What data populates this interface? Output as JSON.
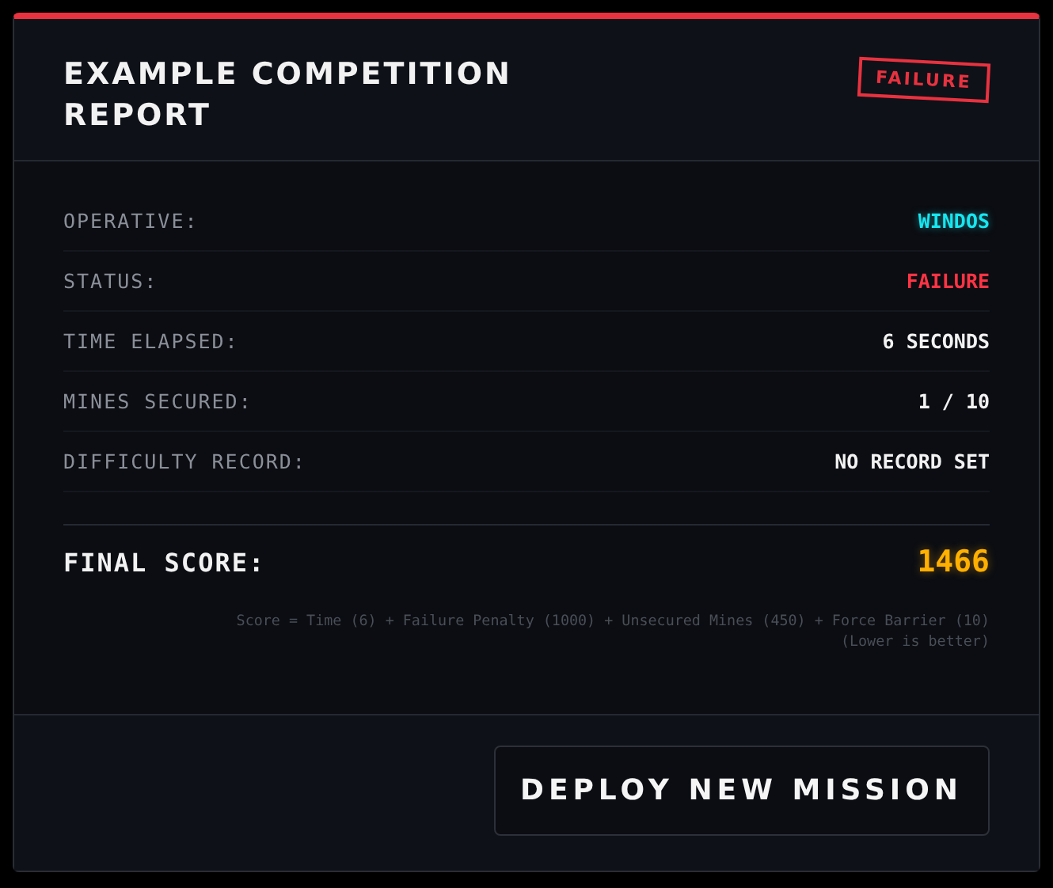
{
  "header": {
    "title": "EXAMPLE COMPETITION REPORT",
    "stamp": "FAILURE",
    "failed": true
  },
  "stats": [
    {
      "label": "OPERATIVE:",
      "value": "WINDOS",
      "kind": "highlight"
    },
    {
      "label": "STATUS:",
      "value": "FAILURE",
      "kind": "failure"
    },
    {
      "label": "TIME ELAPSED:",
      "value": "6 SECONDS",
      "kind": "plain"
    },
    {
      "label": "MINES SECURED:",
      "value": "1 / 10",
      "kind": "plain"
    },
    {
      "label": "DIFFICULTY RECORD:",
      "value": "NO RECORD SET",
      "kind": "plain"
    }
  ],
  "final_score": {
    "label": "FINAL SCORE:",
    "value": "1466"
  },
  "formula": [
    "Score = Time (6) + Failure Penalty (1000) + Unsecured Mines (450) + Force Barrier (10)",
    "(Lower is better)"
  ],
  "button": "DEPLOY NEW MISSION"
}
